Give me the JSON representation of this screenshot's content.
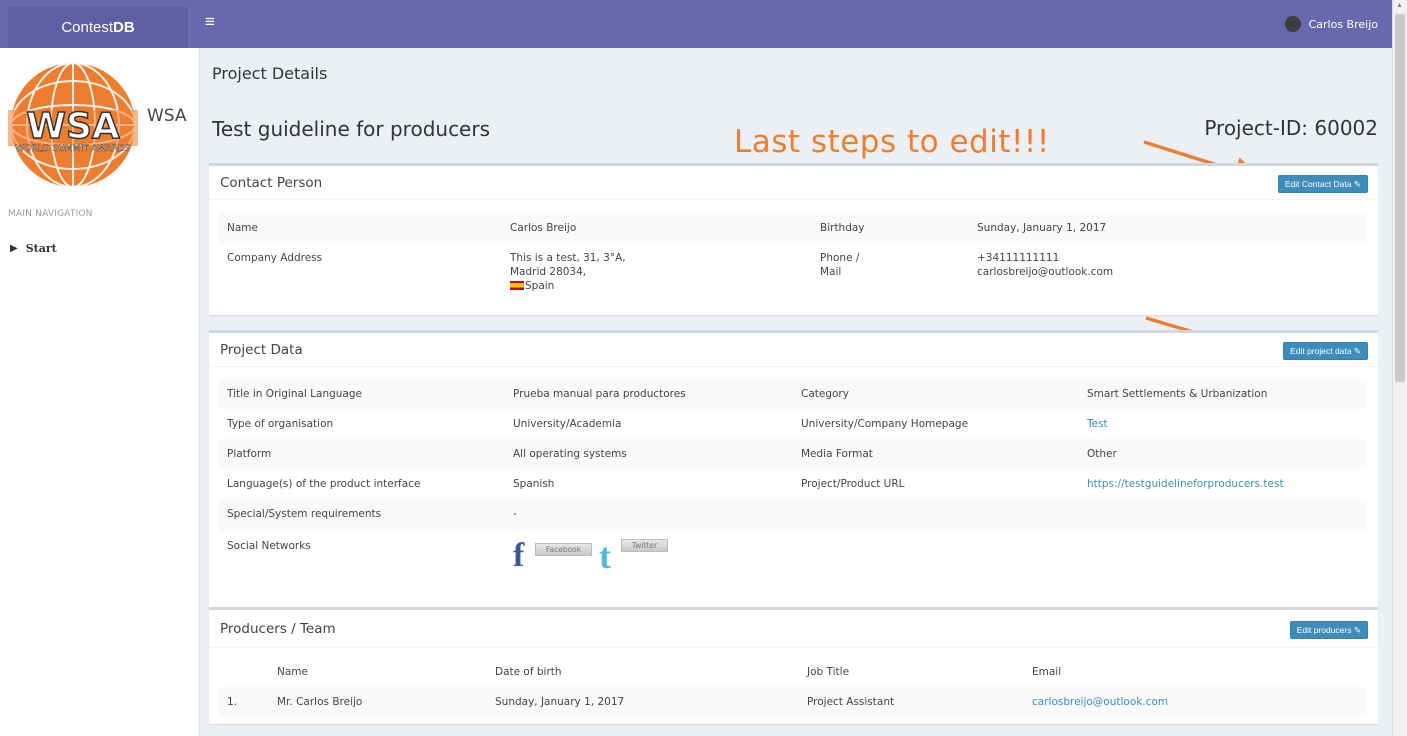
{
  "app": {
    "brand_plain": "Contest",
    "brand_bold": "DB",
    "menu_icon": "hamburger-icon",
    "user_name": "Carlos Breijo"
  },
  "sidebar": {
    "logo_text": "WSA",
    "logo_word": "WSA",
    "logo_ring": "WORLD SUMMIT AWARDS",
    "nav_header": "MAIN NAVIGATION",
    "start_label": "Start"
  },
  "page": {
    "title": "Project Details",
    "project_title": "Test guideline for producers",
    "project_id": "Project-ID: 60002",
    "annotation": "Last steps to edit!!!"
  },
  "contact": {
    "title": "Contact Person",
    "edit_label": "Edit Contact Data",
    "name_label": "Name",
    "name_value": "Carlos Breijo",
    "birthday_label": "Birthday",
    "birthday_value": "Sunday, January 1, 2017",
    "address_label": "Company Address",
    "address_line1": "This is a test, 31, 3°A,",
    "address_line2": "Madrid 28034,",
    "address_country": "Spain",
    "phone_label_1": "Phone /",
    "phone_label_2": "Mail",
    "phone_value": "+34111111111",
    "mail_value": "carlosbreijo@outlook.com"
  },
  "project": {
    "title": "Project Data",
    "edit_label": "Edit project data",
    "rows": [
      {
        "l1": "Title in Original Language",
        "v1": "Prueba manual para productores",
        "l2": "Category",
        "v2": "Smart Settlements & Urbanization"
      },
      {
        "l1": "Type of organisation",
        "v1": "University/Academia",
        "l2": "University/Company Homepage",
        "v2": "Test"
      },
      {
        "l1": "Platform",
        "v1": "All operating systems",
        "l2": "Media Format",
        "v2": "Other"
      },
      {
        "l1": "Language(s) of the product interface",
        "v1": "Spanish",
        "l2": "Project/Product URL",
        "v2": "https://testguidelineforproducers.test"
      },
      {
        "l1": "Special/System requirements",
        "v1": "-",
        "l2": "",
        "v2": ""
      }
    ],
    "social_label": "Social Networks",
    "facebook_label": "Facebook",
    "twitter_label": "Twitter"
  },
  "producers": {
    "title": "Producers / Team",
    "edit_label": "Edit producers",
    "headers": {
      "name": "Name",
      "dob": "Date of birth",
      "job": "Job Title",
      "email": "Email"
    },
    "rows": [
      {
        "num": "1.",
        "name": "Mr. Carlos Breijo",
        "dob": "Sunday, January 1, 2017",
        "job": "Project Assistant",
        "email": "carlosbreijo@outlook.com"
      }
    ]
  },
  "colors": {
    "topbar": "#6a68ad",
    "brand_bg": "#605ea3",
    "button": "#3c8dbc",
    "annotation": "#ee7d2f",
    "logo": "#ee7d2f"
  }
}
